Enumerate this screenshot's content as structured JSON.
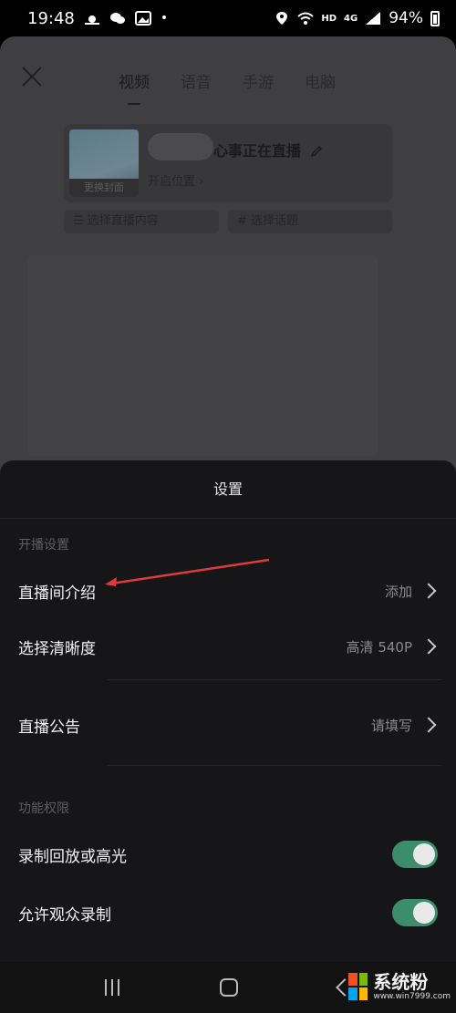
{
  "status_bar": {
    "time": "19:48",
    "network": "HD",
    "signal": "4G",
    "battery": "94%"
  },
  "background": {
    "tabs": [
      "视频",
      "语音",
      "手游",
      "电脑"
    ],
    "active_tab": "视频",
    "cover_label": "更换封面",
    "title": "心事正在直播",
    "location": "开启位置",
    "chip_content": "选择直播内容",
    "chip_topic": "选择话题"
  },
  "sheet": {
    "title": "设置",
    "section_broadcast": "开播设置",
    "rows": [
      {
        "label": "直播间介绍",
        "value": "添加"
      },
      {
        "label": "选择清晰度",
        "value": "高清 540P"
      },
      {
        "label": "直播公告",
        "value": "请填写"
      }
    ],
    "section_permissions": "功能权限",
    "toggles": [
      {
        "label": "录制回放或高光",
        "on": true
      },
      {
        "label": "允许观众录制",
        "on": true
      }
    ]
  },
  "colors": {
    "toggle_on": "#3c8e6a",
    "annotation": "#e03a3a",
    "sheet_bg": "#161618"
  },
  "watermark": {
    "name": "系统粉",
    "url": "www.win7999.com"
  }
}
